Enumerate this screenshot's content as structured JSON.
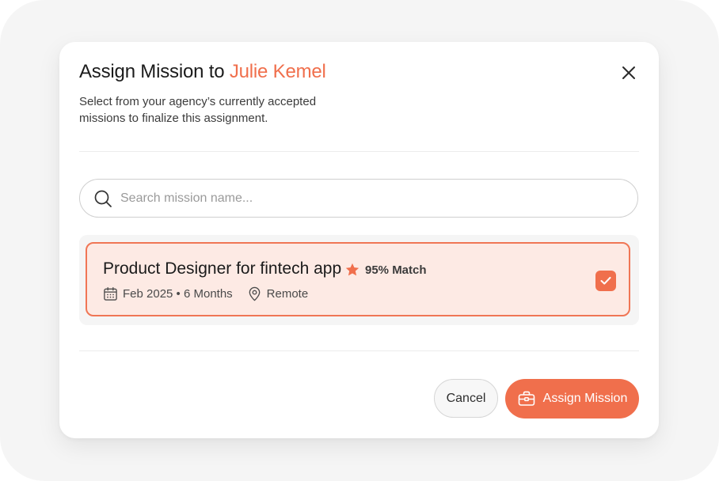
{
  "modal": {
    "title_prefix": "Assign Mission to",
    "title_name": "Julie Kemel",
    "subtitle": "Select from your agency’s currently accepted missions to finalize this assignment."
  },
  "search": {
    "placeholder": "Search mission name...",
    "value": ""
  },
  "missions": [
    {
      "title": "Product Designer for fintech app",
      "match": "95% Match",
      "schedule": "Feb 2025 • 6 Months",
      "location": "Remote",
      "selected": true
    }
  ],
  "footer": {
    "cancel_label": "Cancel",
    "assign_label": "Assign Mission"
  },
  "icons": {
    "close": "close-icon",
    "search": "search-icon",
    "match": "star-icon",
    "schedule": "calendar-icon",
    "location": "location-pin-icon",
    "selected": "check-icon",
    "assign": "briefcase-icon"
  },
  "colors": {
    "accent": "#f06f4c",
    "card_background": "#fdeae4",
    "card_border": "#f07655",
    "text": "#1b1b1b"
  }
}
